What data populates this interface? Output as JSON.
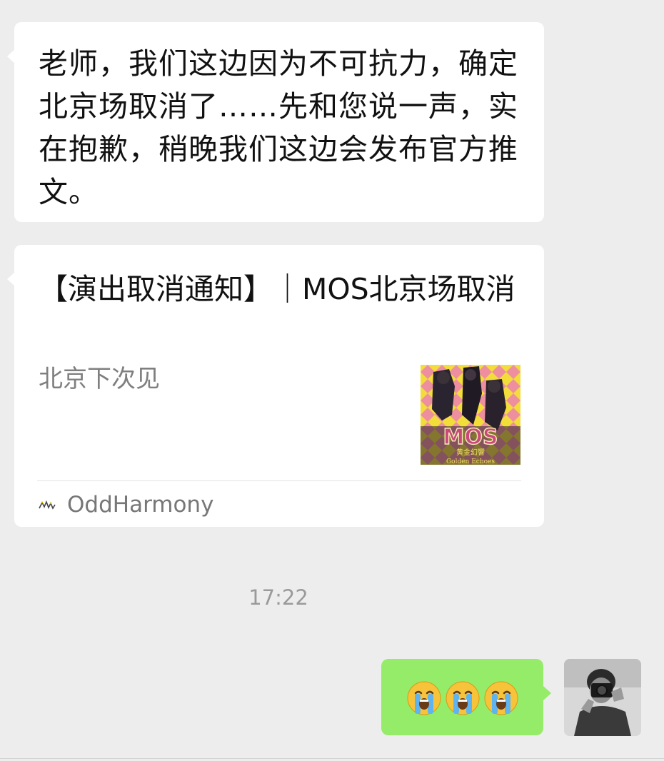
{
  "messages": [
    {
      "side": "left",
      "type": "text",
      "text": "老师，我们这边因为不可抗力，确定北京场取消了……先和您说一声，实在抱歉，稍晚我们这边会发布官方推文。"
    },
    {
      "side": "left",
      "type": "link-card",
      "title": "【演出取消通知】｜MOS北京场取消",
      "subtitle": "北京下次见",
      "thumbnail_label": "MOS",
      "thumbnail_caption_cn": "黄金幻響",
      "thumbnail_caption_en": "Golden Echoes",
      "source": "OddHarmony"
    }
  ],
  "timestamp": "17:22",
  "reply": {
    "side": "right",
    "emojis": [
      "crying-face",
      "crying-face",
      "crying-face"
    ]
  },
  "colors": {
    "background": "#ededed",
    "incoming_bubble": "#ffffff",
    "outgoing_bubble": "#95ec69"
  }
}
